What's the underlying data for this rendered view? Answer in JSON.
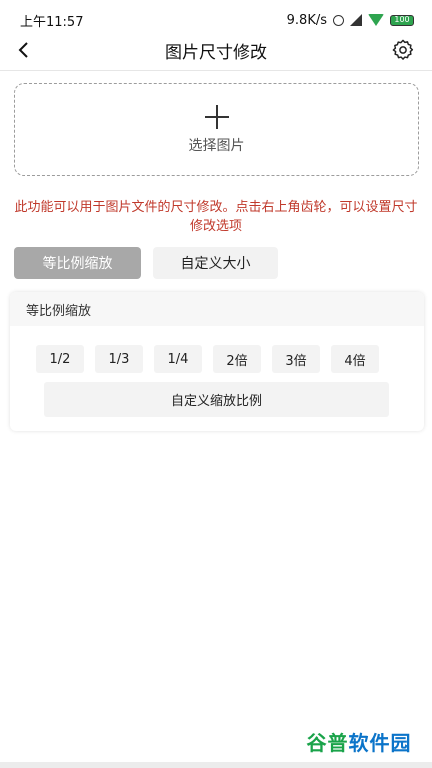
{
  "status": {
    "time": "上午11:57",
    "speed": "9.8K/s",
    "battery": "100"
  },
  "header": {
    "title": "图片尺寸修改"
  },
  "picker": {
    "label": "选择图片"
  },
  "notice": "此功能可以用于图片文件的尺寸修改。点击右上角齿轮，可以设置尺寸修改选项",
  "mode_tabs": [
    {
      "label": "等比例缩放",
      "active": true
    },
    {
      "label": "自定义大小",
      "active": false
    }
  ],
  "scale_card": {
    "title": "等比例缩放",
    "ratios": [
      "1/2",
      "1/3",
      "1/4",
      "2倍",
      "3倍",
      "4倍"
    ],
    "custom_label": "自定义缩放比例"
  },
  "watermark": {
    "part1": "谷普",
    "part2": "软件园"
  },
  "colors": {
    "notice": "#c0392b",
    "active_tab": "#a8a8a8",
    "watermark_green": "#1aa34a",
    "watermark_blue": "#0b74c9"
  }
}
